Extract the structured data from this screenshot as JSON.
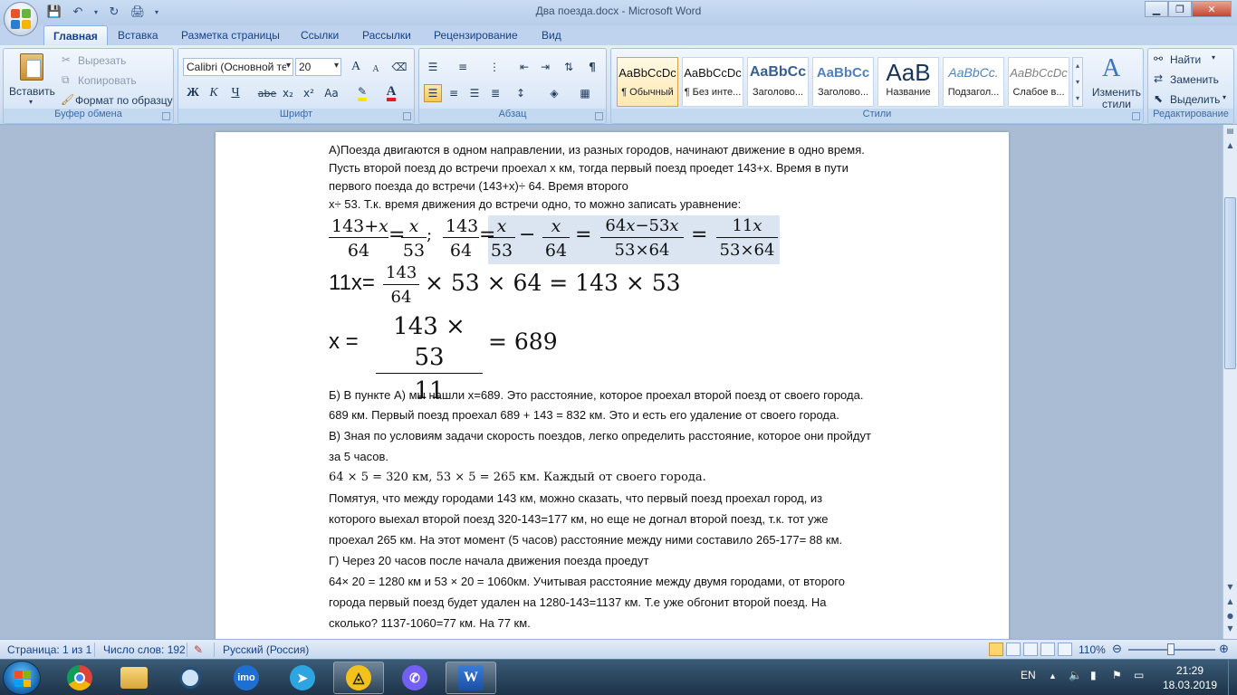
{
  "window": {
    "title": "Два поезда.docx - Microsoft Word",
    "controls": [
      "minimize",
      "maximize",
      "close"
    ]
  },
  "quick_access": [
    "save-icon",
    "undo-icon",
    "redo-icon",
    "print-preview-icon"
  ],
  "tabs": [
    {
      "label": "Главная",
      "active": true
    },
    {
      "label": "Вставка"
    },
    {
      "label": "Разметка страницы"
    },
    {
      "label": "Ссылки"
    },
    {
      "label": "Рассылки"
    },
    {
      "label": "Рецензирование"
    },
    {
      "label": "Вид"
    }
  ],
  "clipboard": {
    "paste": "Вставить",
    "cut": "Вырезать",
    "copy": "Копировать",
    "format_painter": "Формат по образцу",
    "label": "Буфер обмена"
  },
  "font": {
    "name": "Calibri (Основной те",
    "size": "20",
    "label": "Шрифт",
    "bold": "Ж",
    "italic": "К",
    "underline": "Ч",
    "strike": "abe",
    "change_case": "Aa",
    "grow": "A",
    "shrink": "A"
  },
  "paragraph": {
    "label": "Абзац"
  },
  "styles": {
    "label": "Стили",
    "items": [
      {
        "sample": "AaBbCcDc",
        "name": "¶ Обычный",
        "active": true
      },
      {
        "sample": "AaBbCcDc",
        "name": "¶ Без инте..."
      },
      {
        "sample": "AaBbCc",
        "name": "Заголово..."
      },
      {
        "sample": "AaBbCc",
        "name": "Заголово..."
      },
      {
        "sample": "AaB",
        "name": "Название"
      },
      {
        "sample": "AaBbCc.",
        "name": "Подзагол..."
      },
      {
        "sample": "AaBbCcDc",
        "name": "Слабое в..."
      }
    ],
    "change_styles": "Изменить стили"
  },
  "editing": {
    "label": "Редактирование",
    "find": "Найти",
    "replace": "Заменить",
    "select": "Выделить"
  },
  "document": {
    "lines_top": [
      "А)Поезда двигаются в одном направлении, из разных городов, начинают движение в одно время.",
      "Пусть второй поезд до встречи проехал х км, тогда первый поезд проедет 143+х. Время в пути",
      "первого поезда до встречи (143+х)÷ 64. Время второго",
      "х÷ 53. Т.к. время движения до встречи одно, то можно записать уравнение:"
    ],
    "eq1": {
      "f1_num": "143+𝑥",
      "f1_den": "64",
      "eq_a": "=",
      "f2_num": "𝑥",
      "f2_den": "53",
      "sep": ";",
      "f3_num": "143",
      "f3_den": "64",
      "eq_b": "=",
      "f4_num": "𝑥",
      "f4_den": "53",
      "minus": "−",
      "f5_num": "𝑥",
      "f5_den": "64",
      "eq_c": "=",
      "f6_num": "64𝑥−53𝑥",
      "f6_den": "53×64",
      "eq_d": "=",
      "f7_num": "11𝑥",
      "f7_den": "53×64"
    },
    "eq2": {
      "prefix": "11х=",
      "f_num": "143",
      "f_den": "64",
      "suffix": "× 53 × 64 = 143 × 53"
    },
    "eq3": {
      "prefix": "х =",
      "f_num": "143 × 53",
      "f_den": "11",
      "suffix": "= 689"
    },
    "lines_bottom": [
      "Б) В пункте А) мы нашли х=689. Это расстояние, которое  проехал второй поезд от своего города.",
      " 689 км.  Первый поезд проехал 689 + 143 = 832 км. Это и есть его удаление от своего города.",
      "В) Зная по условиям задачи скорость поездов, легко определить расстояние, которое  они пройдут",
      "за 5 часов.",
      "64 × 5 = 320 км, 53 × 5 = 265 км. Каждый от своего города.",
      " Помятуя, что между городами 143 км, можно сказать, что первый поезд проехал  город, из",
      "которого  выехал второй  поезд 320-143=177 км, но еще не догнал второй  поезд, т.к. тот уже",
      "проехал 265 км. На этот момент (5 часов) расстояние между ними составило 265-177= 88 км.",
      "Г) Через 20 часов после  начала движения поезда проедут",
      " 64× 20 = 1280 км и 53 × 20 = 1060км. Учитывая расстояние между двумя городами, от второго",
      "города первый поезд будет удален на 1280-143=1137  км. Т.е уже обгонит второй поезд. На",
      "сколько? 1137-1060=77  км. На 77 км."
    ]
  },
  "status": {
    "page": "Страница: 1 из 1",
    "words": "Число слов: 192",
    "language": "Русский (Россия)",
    "zoom": "110%"
  },
  "taskbar": {
    "apps": [
      "chrome-icon",
      "file-explorer-icon",
      "search-tool-icon",
      "imo-icon",
      "telegram-icon",
      "archicad-icon",
      "viber-icon",
      "word-icon"
    ],
    "imo_label": "imo",
    "lang": "EN",
    "time": "21:29",
    "date": "18.03.2019"
  }
}
